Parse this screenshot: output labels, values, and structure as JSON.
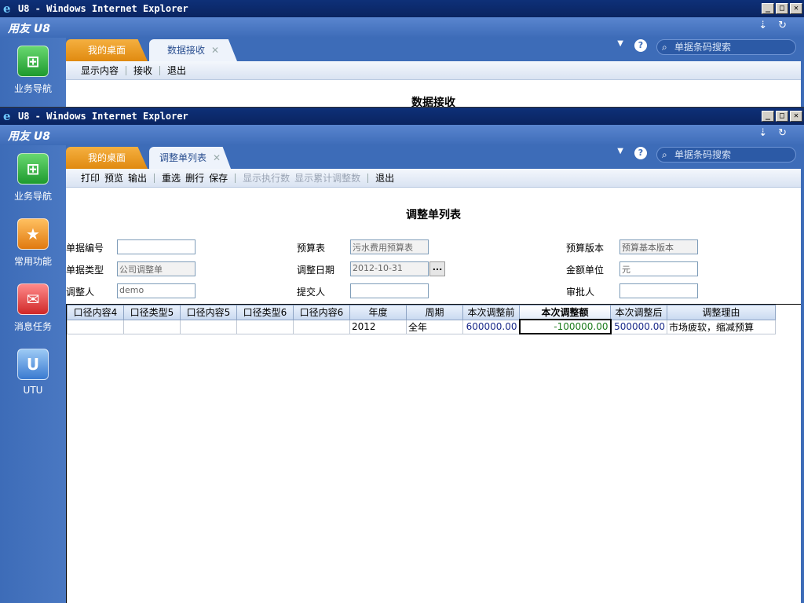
{
  "window_title": "U8 - Windows Internet Explorer",
  "logo": "用友 U8",
  "search_placeholder": "单据条码搜索",
  "nav": {
    "business": "业务导航",
    "common": "常用功能",
    "messages": "消息任务",
    "utu": "UTU"
  },
  "win1": {
    "tab_desktop": "我的桌面",
    "tab_active": "数据接收",
    "toolbar": [
      "显示内容",
      "接收",
      "退出"
    ],
    "heading": "数据接收"
  },
  "win2": {
    "tab_desktop": "我的桌面",
    "tab_active": "调整单列表",
    "toolbar": {
      "print": "打印",
      "preview": "预览",
      "output": "输出",
      "reselect": "重选",
      "delete_row": "删行",
      "save": "保存",
      "show_exec": "显示执行数",
      "show_cum": "显示累计调整数",
      "exit": "退出"
    },
    "page_title": "调整单列表",
    "form": {
      "doc_no_label": "单据编号",
      "doc_no": "",
      "budget_table_label": "预算表",
      "budget_table": "污水费用预算表",
      "budget_version_label": "预算版本",
      "budget_version": "预算基本版本",
      "doc_type_label": "单据类型",
      "doc_type": "公司调整单",
      "adjust_date_label": "调整日期",
      "adjust_date": "2012-10-31",
      "amount_unit_label": "金额单位",
      "amount_unit": "元",
      "adjuster_label": "调整人",
      "adjuster": "demo",
      "submitter_label": "提交人",
      "submitter": "",
      "approver_label": "审批人",
      "approver": ""
    },
    "grid": {
      "columns": [
        "口径内容4",
        "口径类型5",
        "口径内容5",
        "口径类型6",
        "口径内容6",
        "年度",
        "周期",
        "本次调整前",
        "本次调整额",
        "本次调整后",
        "调整理由"
      ],
      "rows": [
        [
          "",
          "",
          "",
          "",
          "",
          "2012",
          "全年",
          "600000.00",
          "-100000.00",
          "500000.00",
          "市场疲软，缩减预算"
        ]
      ]
    }
  }
}
